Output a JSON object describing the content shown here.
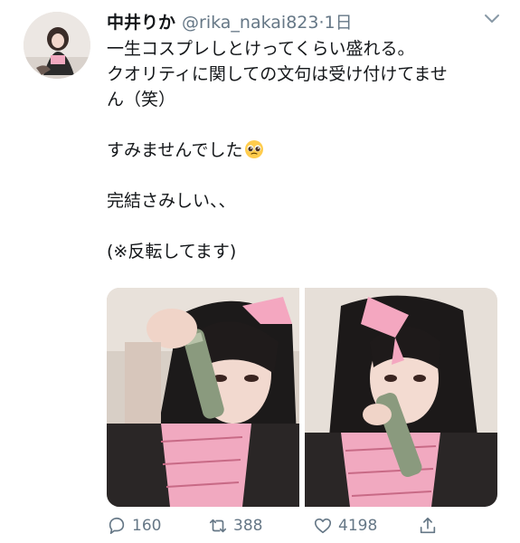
{
  "tweet": {
    "author_name": "中井りか",
    "handle": "@rika_nakai823",
    "separator": "·",
    "time": "1日",
    "lines": [
      "一生コスプレしとけってくらい盛れる。",
      "クオリティに関しての文句は受け付けてませ",
      "ん（笑）",
      "",
      "すみませんでした",
      "",
      "完結さみしい、、",
      "",
      "(※反転してます)"
    ],
    "emoji": "pleading-face-emoji"
  },
  "actions": {
    "reply_count": "160",
    "retweet_count": "388",
    "like_count": "4198"
  },
  "icons": {
    "reply": "speech-bubble-icon",
    "retweet": "retweet-icon",
    "like": "heart-icon",
    "share": "share-icon",
    "menu": "chevron-down-icon"
  },
  "colors": {
    "text": "#14171a",
    "secondary": "#657786",
    "kimono_pink": "#f1a9c0",
    "ribbon_pink": "#f4a7c0"
  }
}
